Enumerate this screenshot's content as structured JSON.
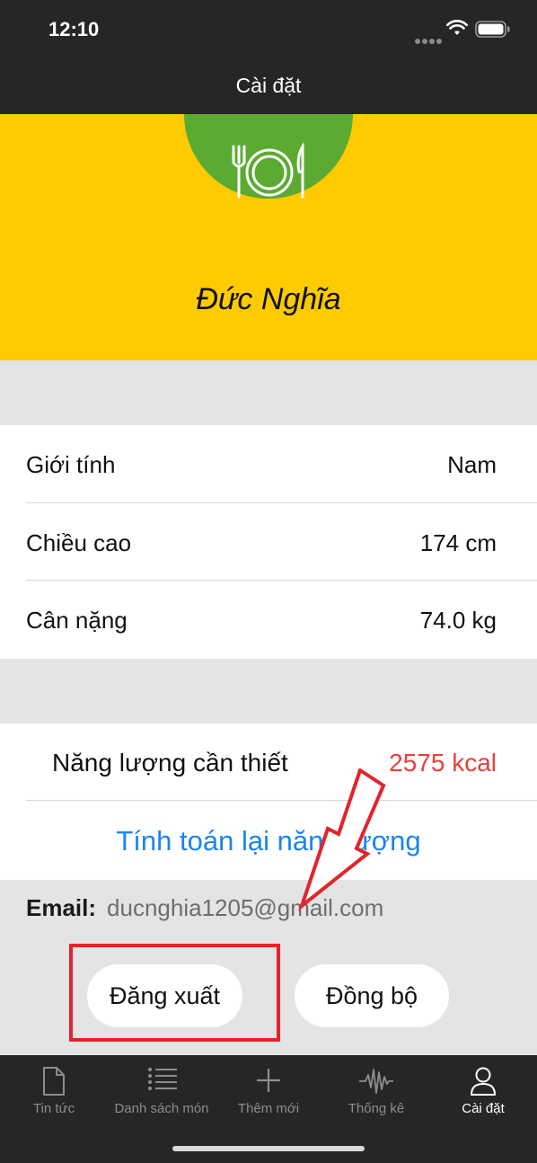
{
  "status_bar": {
    "time": "12:10"
  },
  "nav": {
    "title": "Cài đặt"
  },
  "profile": {
    "name": "Đức Nghĩa",
    "avatar_icon": "fork-plate-knife-icon",
    "avatar_color": "#5bab33",
    "header_color": "#fecb00"
  },
  "info": {
    "rows": [
      {
        "label": "Giới tính",
        "value": "Nam"
      },
      {
        "label": "Chiều cao",
        "value": "174 cm"
      },
      {
        "label": "Cân nặng",
        "value": "74.0 kg"
      }
    ]
  },
  "energy": {
    "label": "Năng lượng cần thiết",
    "value": "2575 kcal",
    "value_color": "#e8403a",
    "recalculate_label": "Tính toán lại năng lượng",
    "link_color": "#1a84f0"
  },
  "account": {
    "email_label": "Email:",
    "email": "ducnghia1205@gmail.com",
    "logout_label": "Đăng xuất",
    "sync_label": "Đồng bộ"
  },
  "annotation": {
    "highlight_color": "#e3232b"
  },
  "tabs": [
    {
      "label": "Tin tức",
      "icon": "document-icon",
      "active": false
    },
    {
      "label": "Danh sách món",
      "icon": "list-icon",
      "active": false
    },
    {
      "label": "Thêm mới",
      "icon": "plus-icon",
      "active": false
    },
    {
      "label": "Thống kê",
      "icon": "waveform-icon",
      "active": false
    },
    {
      "label": "Cài đặt",
      "icon": "person-icon",
      "active": true
    }
  ]
}
